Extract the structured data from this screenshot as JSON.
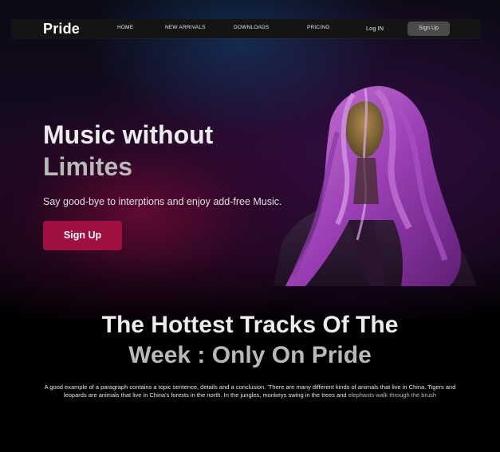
{
  "nav": {
    "logo": "Pride",
    "links": [
      "HOME",
      "NEW ARRIVALS",
      "DOWNLOADS",
      "PRICING"
    ],
    "login": "Log IN",
    "signup": "Sign Up"
  },
  "hero": {
    "title_line1": "Music without",
    "title_line2": "Limites",
    "subtitle": "Say good-bye to interptions and enjoy add-free Music.",
    "button": "Sign Up"
  },
  "section": {
    "title_line1": "The Hottest Tracks Of The",
    "title_line2": "Week : Only On Pride",
    "paragraph_main": "A good example of a paragraph contains a topic sentence, details and a conclusion. 'There are many different kinds of animals that live in China. Tigers and leopards are animals that live in China's forests in the north. In the jungles, monkeys swing in the trees and",
    "paragraph_end": "elephants walk through the brush"
  },
  "colors": {
    "accent": "#a0103f",
    "background": "#000000",
    "navbar": "#141414",
    "signup_nav": "#4a4a4a",
    "hair_tint": "#9b3fb5"
  }
}
